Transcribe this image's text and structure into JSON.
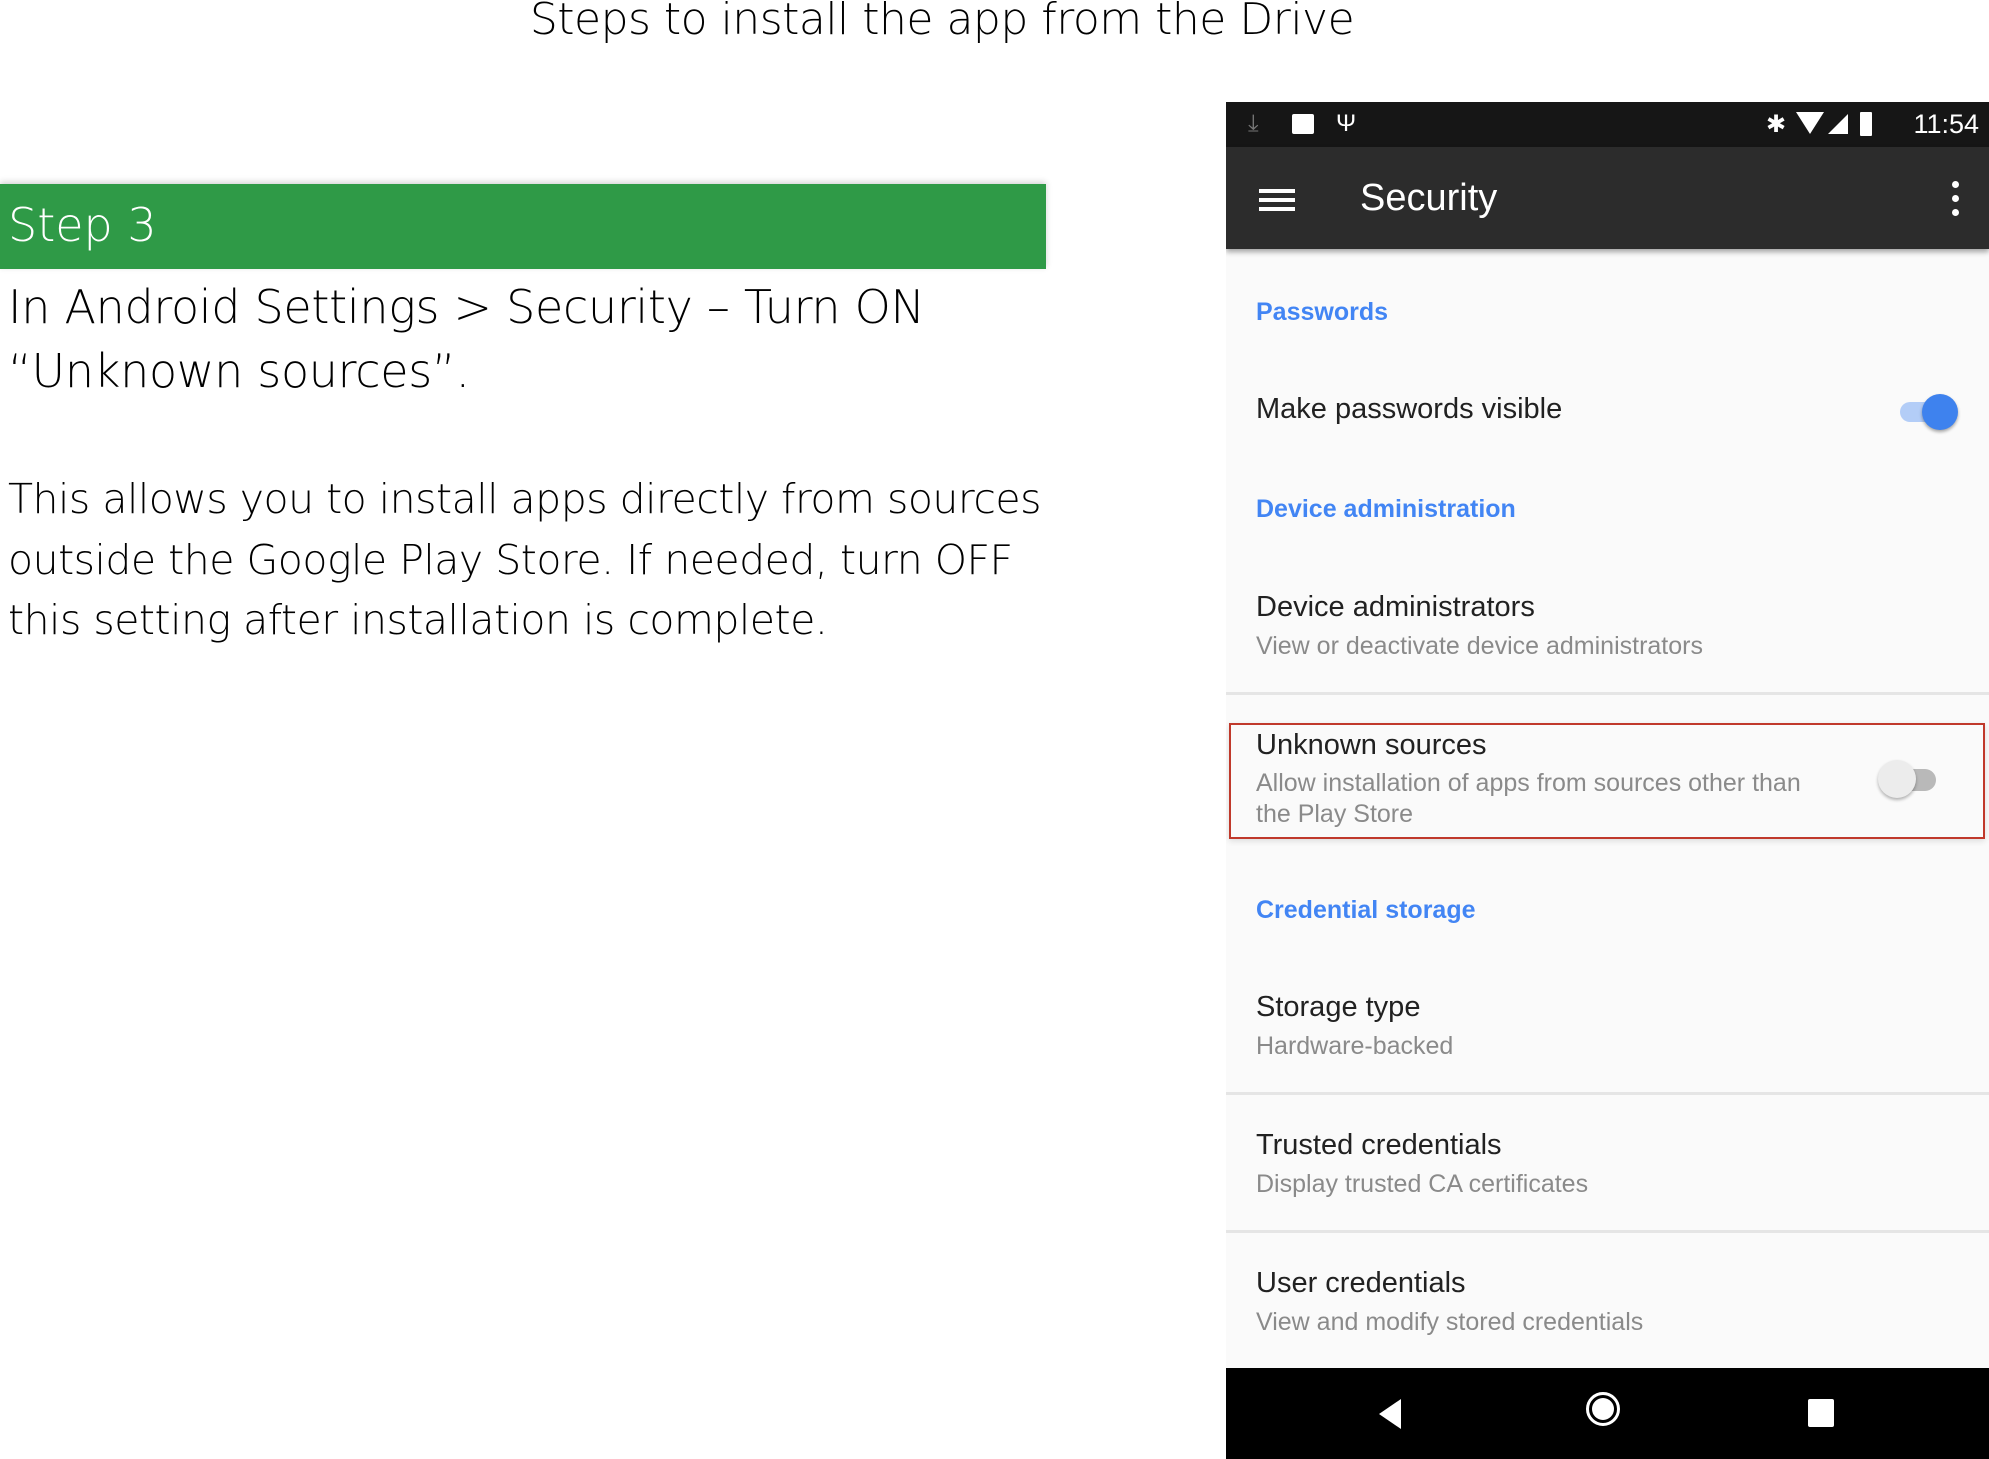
{
  "slide": {
    "title": "Steps to install the app from the Drive",
    "step_label": "Step 3",
    "instruction_lines": [
      "In Android Settings > Security – Turn ON",
      "“Unknown sources”."
    ],
    "paragraph_lines": [
      "This allows you to install apps directly from sources",
      "outside the Google Play Store. If needed, turn OFF",
      "this setting after installation is complete."
    ],
    "accent_color": "#2f9a47"
  },
  "phone": {
    "status_bar": {
      "left_icons": [
        "download-icon",
        "image-icon",
        "usb-icon"
      ],
      "right_icons": [
        "bluetooth-icon",
        "wifi-icon",
        "signal-icon",
        "battery-icon"
      ],
      "time": "11:54"
    },
    "toolbar": {
      "title": "Security",
      "menu_icon": "hamburger-menu-icon",
      "overflow_icon": "more-vert-icon"
    },
    "sections": [
      {
        "header": "Passwords",
        "items": [
          {
            "title": "Make passwords visible",
            "toggle": true
          }
        ]
      },
      {
        "header": "Device administration",
        "items": [
          {
            "title": "Device administrators",
            "subtitle": "View or deactivate device administrators"
          },
          {
            "title": "Unknown sources",
            "subtitle_lines": [
              "Allow installation of apps from sources other than",
              "the Play Store"
            ],
            "toggle": false,
            "highlighted": true
          }
        ]
      },
      {
        "header": "Credential storage",
        "items": [
          {
            "title": "Storage type",
            "subtitle": "Hardware-backed"
          },
          {
            "title": "Trusted credentials",
            "subtitle": "Display trusted CA certificates"
          },
          {
            "title": "User credentials",
            "subtitle": "View and modify stored credentials"
          }
        ]
      }
    ],
    "nav_bar": [
      "back-icon",
      "home-icon",
      "recents-icon"
    ],
    "highlight_color": "#c0392b",
    "section_header_color": "#4285f4"
  }
}
